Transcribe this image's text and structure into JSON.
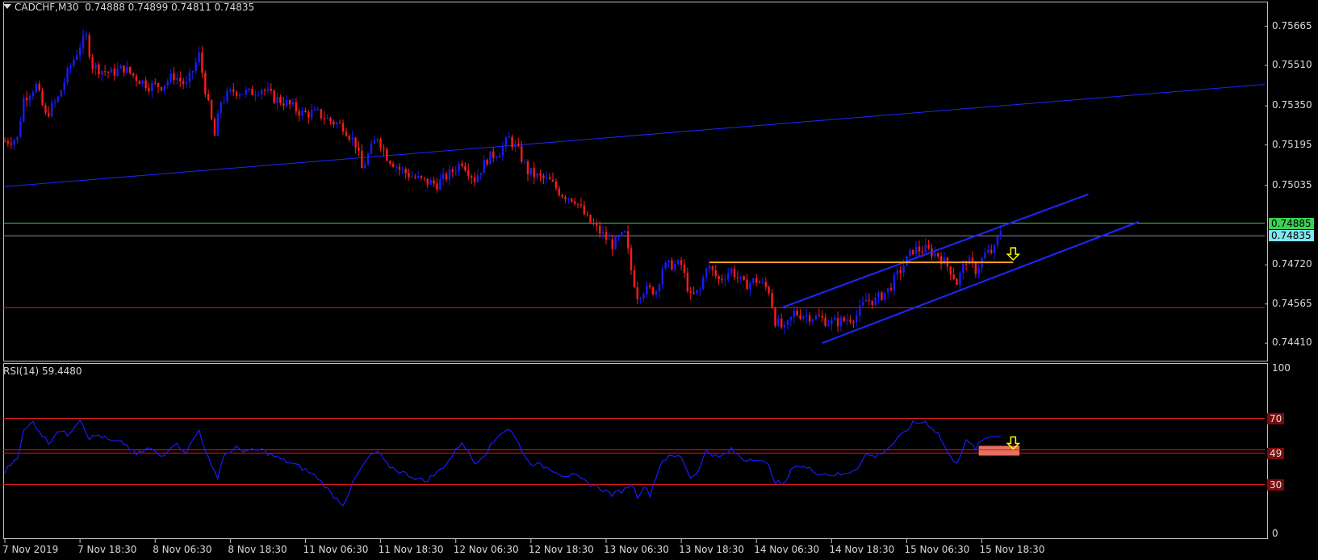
{
  "header": {
    "symbol": "CADCHF,M30",
    "ohlc": "0.74888 0.74899 0.74811 0.74835"
  },
  "rsi_header": "RSI(14) 59.4480",
  "colors": {
    "bull": "#1a1aff",
    "bear": "#ff1a1a",
    "channel": "#1e28ff",
    "green_level": "#39d353",
    "red_level": "#e01818",
    "orange_level": "#ffa020",
    "arrow": "#ffff00",
    "rsi_line": "#1a1aff",
    "rsi_level": "#e01818"
  },
  "chart_data": [
    {
      "type": "candlestick",
      "title": "CADCHF,M30",
      "ylim": [
        0.7435,
        0.7575
      ],
      "y_ticks": [
        "0.75665",
        "0.75510",
        "0.75350",
        "0.75195",
        "0.75035",
        "0.74720",
        "0.74565",
        "0.74410"
      ],
      "current_price": "0.74835",
      "tagged_level": "0.74885",
      "x_ticks": [
        "7 Nov 2019",
        "7 Nov 18:30",
        "8 Nov 06:30",
        "8 Nov 18:30",
        "11 Nov 06:30",
        "11 Nov 18:30",
        "12 Nov 06:30",
        "12 Nov 18:30",
        "13 Nov 06:30",
        "13 Nov 18:30",
        "14 Nov 06:30",
        "14 Nov 18:30",
        "15 Nov 06:30",
        "15 Nov 18:30"
      ],
      "x_tick_index": [
        0,
        24,
        48,
        72,
        96,
        120,
        144,
        168,
        192,
        216,
        240,
        264,
        288,
        312
      ],
      "close_path": [
        [
          0,
          0.7521
        ],
        [
          4,
          0.7522
        ],
        [
          6,
          0.7538
        ],
        [
          10,
          0.7543
        ],
        [
          13,
          0.7531
        ],
        [
          17,
          0.7538
        ],
        [
          20,
          0.7548
        ],
        [
          24,
          0.7559
        ],
        [
          26,
          0.7562
        ],
        [
          28,
          0.7551
        ],
        [
          31,
          0.7549
        ],
        [
          34,
          0.7548
        ],
        [
          38,
          0.755
        ],
        [
          42,
          0.7546
        ],
        [
          46,
          0.7543
        ],
        [
          50,
          0.7543
        ],
        [
          54,
          0.7547
        ],
        [
          58,
          0.7543
        ],
        [
          62,
          0.7555
        ],
        [
          65,
          0.7535
        ],
        [
          67,
          0.7523
        ],
        [
          69,
          0.7537
        ],
        [
          73,
          0.7541
        ],
        [
          78,
          0.754
        ],
        [
          82,
          0.7542
        ],
        [
          86,
          0.7538
        ],
        [
          90,
          0.7536
        ],
        [
          95,
          0.7532
        ],
        [
          100,
          0.7532
        ],
        [
          104,
          0.7529
        ],
        [
          108,
          0.7527
        ],
        [
          112,
          0.752
        ],
        [
          114,
          0.751
        ],
        [
          117,
          0.7518
        ],
        [
          119,
          0.7523
        ],
        [
          122,
          0.7515
        ],
        [
          126,
          0.751
        ],
        [
          130,
          0.7507
        ],
        [
          134,
          0.7505
        ],
        [
          138,
          0.7504
        ],
        [
          142,
          0.7508
        ],
        [
          146,
          0.7513
        ],
        [
          150,
          0.7506
        ],
        [
          154,
          0.7514
        ],
        [
          158,
          0.7517
        ],
        [
          161,
          0.7522
        ],
        [
          164,
          0.7517
        ],
        [
          167,
          0.7509
        ],
        [
          170,
          0.7507
        ],
        [
          174,
          0.7505
        ],
        [
          178,
          0.75
        ],
        [
          182,
          0.7498
        ],
        [
          186,
          0.749
        ],
        [
          190,
          0.7485
        ],
        [
          194,
          0.748
        ],
        [
          198,
          0.7484
        ],
        [
          200,
          0.747
        ],
        [
          202,
          0.746
        ],
        [
          204,
          0.7462
        ],
        [
          208,
          0.7462
        ],
        [
          210,
          0.7471
        ],
        [
          213,
          0.7472
        ],
        [
          216,
          0.7472
        ],
        [
          219,
          0.7459
        ],
        [
          222,
          0.7462
        ],
        [
          224,
          0.7472
        ],
        [
          228,
          0.7466
        ],
        [
          232,
          0.747
        ],
        [
          236,
          0.7464
        ],
        [
          240,
          0.7466
        ],
        [
          244,
          0.7462
        ],
        [
          246,
          0.745
        ],
        [
          249,
          0.7446
        ],
        [
          252,
          0.7453
        ],
        [
          256,
          0.7452
        ],
        [
          260,
          0.7451
        ],
        [
          264,
          0.7449
        ],
        [
          268,
          0.745
        ],
        [
          272,
          0.7452
        ],
        [
          275,
          0.7458
        ],
        [
          278,
          0.7458
        ],
        [
          282,
          0.7462
        ],
        [
          286,
          0.747
        ],
        [
          290,
          0.7478
        ],
        [
          294,
          0.7478
        ],
        [
          298,
          0.7476
        ],
        [
          302,
          0.747
        ],
        [
          304,
          0.7465
        ],
        [
          307,
          0.7474
        ],
        [
          310,
          0.747
        ],
        [
          313,
          0.7476
        ],
        [
          316,
          0.7478
        ],
        [
          318,
          0.7486
        ]
      ],
      "channel_upper": [
        [
          248,
          0.7455
        ],
        [
          346,
          0.75
        ]
      ],
      "channel_lower": [
        [
          261,
          0.7441
        ],
        [
          362,
          0.7489
        ]
      ],
      "long_trendline": [
        [
          0,
          0.7503
        ],
        [
          338,
          0.7537
        ]
      ],
      "orange_level": {
        "value": 0.7473,
        "from": 225,
        "to": 322
      },
      "green_level": 0.74885,
      "red_level": 0.7455,
      "arrow_index": 322
    },
    {
      "type": "line",
      "title": "RSI(14)",
      "ylim": [
        0,
        100
      ],
      "y_ticks": [
        "100",
        "70",
        "49",
        "30",
        "0"
      ],
      "levels": [
        70,
        49,
        30
      ],
      "series": [
        {
          "values": [
            [
              0,
              38
            ],
            [
              4,
              47
            ],
            [
              6,
              62
            ],
            [
              9,
              68
            ],
            [
              12,
              60
            ],
            [
              14,
              55
            ],
            [
              17,
              63
            ],
            [
              20,
              60
            ],
            [
              24,
              70
            ],
            [
              27,
              58
            ],
            [
              30,
              60
            ],
            [
              34,
              56
            ],
            [
              38,
              55
            ],
            [
              42,
              48
            ],
            [
              46,
              52
            ],
            [
              50,
              47
            ],
            [
              54,
              55
            ],
            [
              58,
              50
            ],
            [
              62,
              63
            ],
            [
              66,
              40
            ],
            [
              68,
              35
            ],
            [
              70,
              48
            ],
            [
              74,
              52
            ],
            [
              78,
              50
            ],
            [
              82,
              51
            ],
            [
              86,
              47
            ],
            [
              90,
              44
            ],
            [
              95,
              40
            ],
            [
              100,
              34
            ],
            [
              104,
              25
            ],
            [
              108,
              18
            ],
            [
              112,
              34
            ],
            [
              116,
              46
            ],
            [
              119,
              50
            ],
            [
              122,
              42
            ],
            [
              126,
              38
            ],
            [
              130,
              35
            ],
            [
              134,
              32
            ],
            [
              138,
              37
            ],
            [
              142,
              45
            ],
            [
              146,
              56
            ],
            [
              150,
              43
            ],
            [
              154,
              50
            ],
            [
              158,
              61
            ],
            [
              161,
              64
            ],
            [
              164,
              55
            ],
            [
              167,
              44
            ],
            [
              170,
              42
            ],
            [
              174,
              40
            ],
            [
              178,
              36
            ],
            [
              182,
              35
            ],
            [
              186,
              31
            ],
            [
              190,
              28
            ],
            [
              194,
              24
            ],
            [
              198,
              27
            ],
            [
              200,
              31
            ],
            [
              202,
              23
            ],
            [
              204,
              29
            ],
            [
              206,
              24
            ],
            [
              208,
              35
            ],
            [
              210,
              45
            ],
            [
              213,
              47
            ],
            [
              216,
              47
            ],
            [
              219,
              34
            ],
            [
              222,
              40
            ],
            [
              224,
              51
            ],
            [
              228,
              46
            ],
            [
              232,
              51
            ],
            [
              236,
              45
            ],
            [
              240,
              46
            ],
            [
              244,
              41
            ],
            [
              246,
              32
            ],
            [
              249,
              30
            ],
            [
              252,
              42
            ],
            [
              256,
              40
            ],
            [
              260,
              37
            ],
            [
              264,
              36
            ],
            [
              268,
              36
            ],
            [
              272,
              40
            ],
            [
              275,
              48
            ],
            [
              278,
              47
            ],
            [
              282,
              52
            ],
            [
              286,
              59
            ],
            [
              290,
              67
            ],
            [
              294,
              68
            ],
            [
              298,
              61
            ],
            [
              302,
              46
            ],
            [
              304,
              44
            ],
            [
              307,
              56
            ],
            [
              310,
              52
            ],
            [
              313,
              58
            ],
            [
              316,
              60
            ],
            [
              318,
              59.4
            ]
          ]
        }
      ],
      "highlight_index": [
        311,
        324
      ],
      "arrow_index": 322
    }
  ]
}
